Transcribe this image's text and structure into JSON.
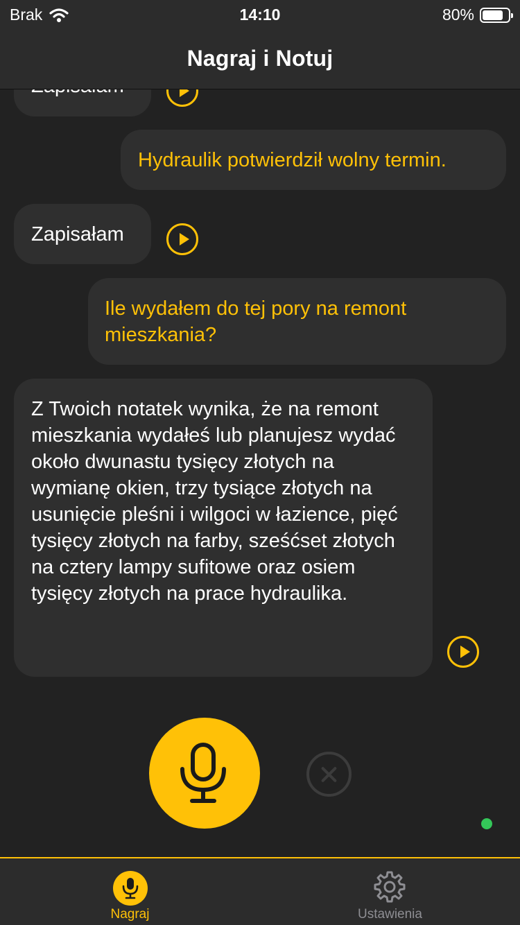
{
  "status_bar": {
    "carrier": "Brak",
    "time": "14:10",
    "battery": "80%",
    "battery_level": 0.8
  },
  "header": {
    "title": "Nagraj i Notuj"
  },
  "messages": [
    {
      "role": "bot",
      "text": "Zapisałam"
    },
    {
      "role": "user",
      "text": "Hydraulik potwierdził wolny termin."
    },
    {
      "role": "bot",
      "text": "Zapisałam"
    },
    {
      "role": "user",
      "text": "Ile wydałem do tej pory na remont mieszkania?"
    },
    {
      "role": "bot",
      "text": "Z Twoich notatek wynika, że na remont mieszkania wydałeś lub planujesz wydać około dwunastu tysięcy złotych na wymianę okien, trzy tysiące złotych na usunięcie pleśni i wilgoci w łazience, pięć tysięcy złotych na farby, sześćset złotych na cztery lampy sufitowe oraz osiem tysięcy złotych na prace hydraulika."
    }
  ],
  "controls": {
    "mic_icon": "microphone-icon",
    "cancel_icon": "close-icon"
  },
  "tab_bar": {
    "tabs": [
      {
        "label": "Nagraj",
        "icon": "microphone-icon",
        "active": true
      },
      {
        "label": "Ustawienia",
        "icon": "gear-icon",
        "active": false
      }
    ]
  },
  "colors": {
    "accent": "#ffc107",
    "background": "#222222",
    "bubble": "#2f2f2f",
    "bars": "#2c2c2c",
    "indicator": "#34c759"
  }
}
